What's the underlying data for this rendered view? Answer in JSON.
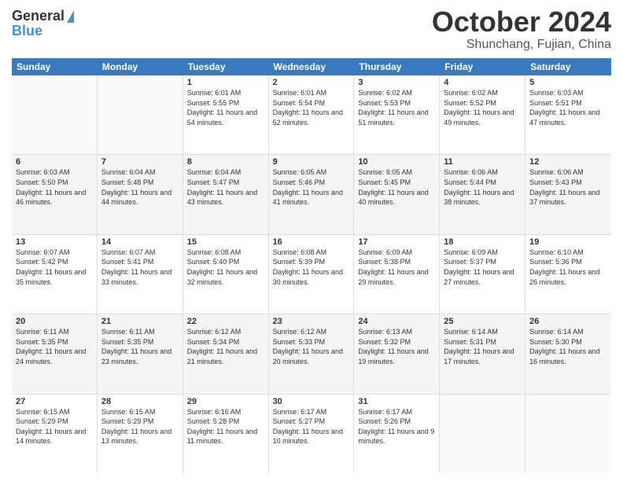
{
  "header": {
    "logo_line1": "General",
    "logo_line2": "Blue",
    "month": "October 2024",
    "location": "Shunchang, Fujian, China"
  },
  "days_of_week": [
    "Sunday",
    "Monday",
    "Tuesday",
    "Wednesday",
    "Thursday",
    "Friday",
    "Saturday"
  ],
  "weeks": [
    [
      {
        "day": "",
        "info": ""
      },
      {
        "day": "",
        "info": ""
      },
      {
        "day": "1",
        "info": "Sunrise: 6:01 AM\nSunset: 5:55 PM\nDaylight: 11 hours and 54 minutes."
      },
      {
        "day": "2",
        "info": "Sunrise: 6:01 AM\nSunset: 5:54 PM\nDaylight: 11 hours and 52 minutes."
      },
      {
        "day": "3",
        "info": "Sunrise: 6:02 AM\nSunset: 5:53 PM\nDaylight: 11 hours and 51 minutes."
      },
      {
        "day": "4",
        "info": "Sunrise: 6:02 AM\nSunset: 5:52 PM\nDaylight: 11 hours and 49 minutes."
      },
      {
        "day": "5",
        "info": "Sunrise: 6:03 AM\nSunset: 5:51 PM\nDaylight: 11 hours and 47 minutes."
      }
    ],
    [
      {
        "day": "6",
        "info": "Sunrise: 6:03 AM\nSunset: 5:50 PM\nDaylight: 11 hours and 46 minutes."
      },
      {
        "day": "7",
        "info": "Sunrise: 6:04 AM\nSunset: 5:48 PM\nDaylight: 11 hours and 44 minutes."
      },
      {
        "day": "8",
        "info": "Sunrise: 6:04 AM\nSunset: 5:47 PM\nDaylight: 11 hours and 43 minutes."
      },
      {
        "day": "9",
        "info": "Sunrise: 6:05 AM\nSunset: 5:46 PM\nDaylight: 11 hours and 41 minutes."
      },
      {
        "day": "10",
        "info": "Sunrise: 6:05 AM\nSunset: 5:45 PM\nDaylight: 11 hours and 40 minutes."
      },
      {
        "day": "11",
        "info": "Sunrise: 6:06 AM\nSunset: 5:44 PM\nDaylight: 11 hours and 38 minutes."
      },
      {
        "day": "12",
        "info": "Sunrise: 6:06 AM\nSunset: 5:43 PM\nDaylight: 11 hours and 37 minutes."
      }
    ],
    [
      {
        "day": "13",
        "info": "Sunrise: 6:07 AM\nSunset: 5:42 PM\nDaylight: 11 hours and 35 minutes."
      },
      {
        "day": "14",
        "info": "Sunrise: 6:07 AM\nSunset: 5:41 PM\nDaylight: 11 hours and 33 minutes."
      },
      {
        "day": "15",
        "info": "Sunrise: 6:08 AM\nSunset: 5:40 PM\nDaylight: 11 hours and 32 minutes."
      },
      {
        "day": "16",
        "info": "Sunrise: 6:08 AM\nSunset: 5:39 PM\nDaylight: 11 hours and 30 minutes."
      },
      {
        "day": "17",
        "info": "Sunrise: 6:09 AM\nSunset: 5:38 PM\nDaylight: 11 hours and 29 minutes."
      },
      {
        "day": "18",
        "info": "Sunrise: 6:09 AM\nSunset: 5:37 PM\nDaylight: 11 hours and 27 minutes."
      },
      {
        "day": "19",
        "info": "Sunrise: 6:10 AM\nSunset: 5:36 PM\nDaylight: 11 hours and 26 minutes."
      }
    ],
    [
      {
        "day": "20",
        "info": "Sunrise: 6:11 AM\nSunset: 5:35 PM\nDaylight: 11 hours and 24 minutes."
      },
      {
        "day": "21",
        "info": "Sunrise: 6:11 AM\nSunset: 5:35 PM\nDaylight: 11 hours and 23 minutes."
      },
      {
        "day": "22",
        "info": "Sunrise: 6:12 AM\nSunset: 5:34 PM\nDaylight: 11 hours and 21 minutes."
      },
      {
        "day": "23",
        "info": "Sunrise: 6:12 AM\nSunset: 5:33 PM\nDaylight: 11 hours and 20 minutes."
      },
      {
        "day": "24",
        "info": "Sunrise: 6:13 AM\nSunset: 5:32 PM\nDaylight: 11 hours and 19 minutes."
      },
      {
        "day": "25",
        "info": "Sunrise: 6:14 AM\nSunset: 5:31 PM\nDaylight: 11 hours and 17 minutes."
      },
      {
        "day": "26",
        "info": "Sunrise: 6:14 AM\nSunset: 5:30 PM\nDaylight: 11 hours and 16 minutes."
      }
    ],
    [
      {
        "day": "27",
        "info": "Sunrise: 6:15 AM\nSunset: 5:29 PM\nDaylight: 11 hours and 14 minutes."
      },
      {
        "day": "28",
        "info": "Sunrise: 6:15 AM\nSunset: 5:29 PM\nDaylight: 11 hours and 13 minutes."
      },
      {
        "day": "29",
        "info": "Sunrise: 6:16 AM\nSunset: 5:28 PM\nDaylight: 11 hours and 11 minutes."
      },
      {
        "day": "30",
        "info": "Sunrise: 6:17 AM\nSunset: 5:27 PM\nDaylight: 11 hours and 10 minutes."
      },
      {
        "day": "31",
        "info": "Sunrise: 6:17 AM\nSunset: 5:26 PM\nDaylight: 11 hours and 9 minutes."
      },
      {
        "day": "",
        "info": ""
      },
      {
        "day": "",
        "info": ""
      }
    ]
  ]
}
